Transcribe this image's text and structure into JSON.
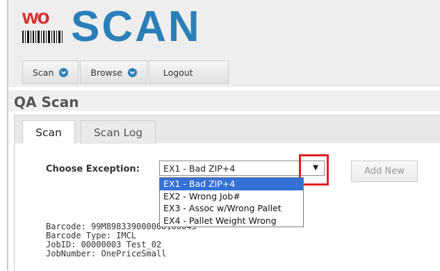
{
  "app": {
    "logo_prefix": "wo",
    "logo_main": "SCAN"
  },
  "nav": [
    {
      "label": "Scan",
      "has_dropdown": true,
      "icon": "chevron-down-icon"
    },
    {
      "label": "Browse",
      "has_dropdown": true,
      "icon": "chevron-down-icon"
    },
    {
      "label": "Logout",
      "has_dropdown": false
    }
  ],
  "page": {
    "title": "QA Scan"
  },
  "tabs": [
    {
      "label": "Scan",
      "active": true
    },
    {
      "label": "Scan Log",
      "active": false
    }
  ],
  "form": {
    "exception_label": "Choose Exception:",
    "selected_value": "EX1 - Bad ZIP+4",
    "options": [
      "EX1 - Bad ZIP+4",
      "EX2 - Wrong Job#",
      "EX3 - Assoc w/Wrong Pallet",
      "EX4 - Pallet Weight Wrong"
    ],
    "highlighted_option": 0,
    "add_button_label": "Add New"
  },
  "scan_info": [
    "Barcode: 99M898339000000100043",
    "Barcode Type: IMCL",
    "JobID: 00000003 Test_02",
    "JobNumber: OnePriceSmall"
  ],
  "colors": {
    "brand_blue": "#2b7fb8",
    "brand_red": "#d92b2b",
    "selection_blue": "#3470d6",
    "annotation_red": "#e02020"
  }
}
